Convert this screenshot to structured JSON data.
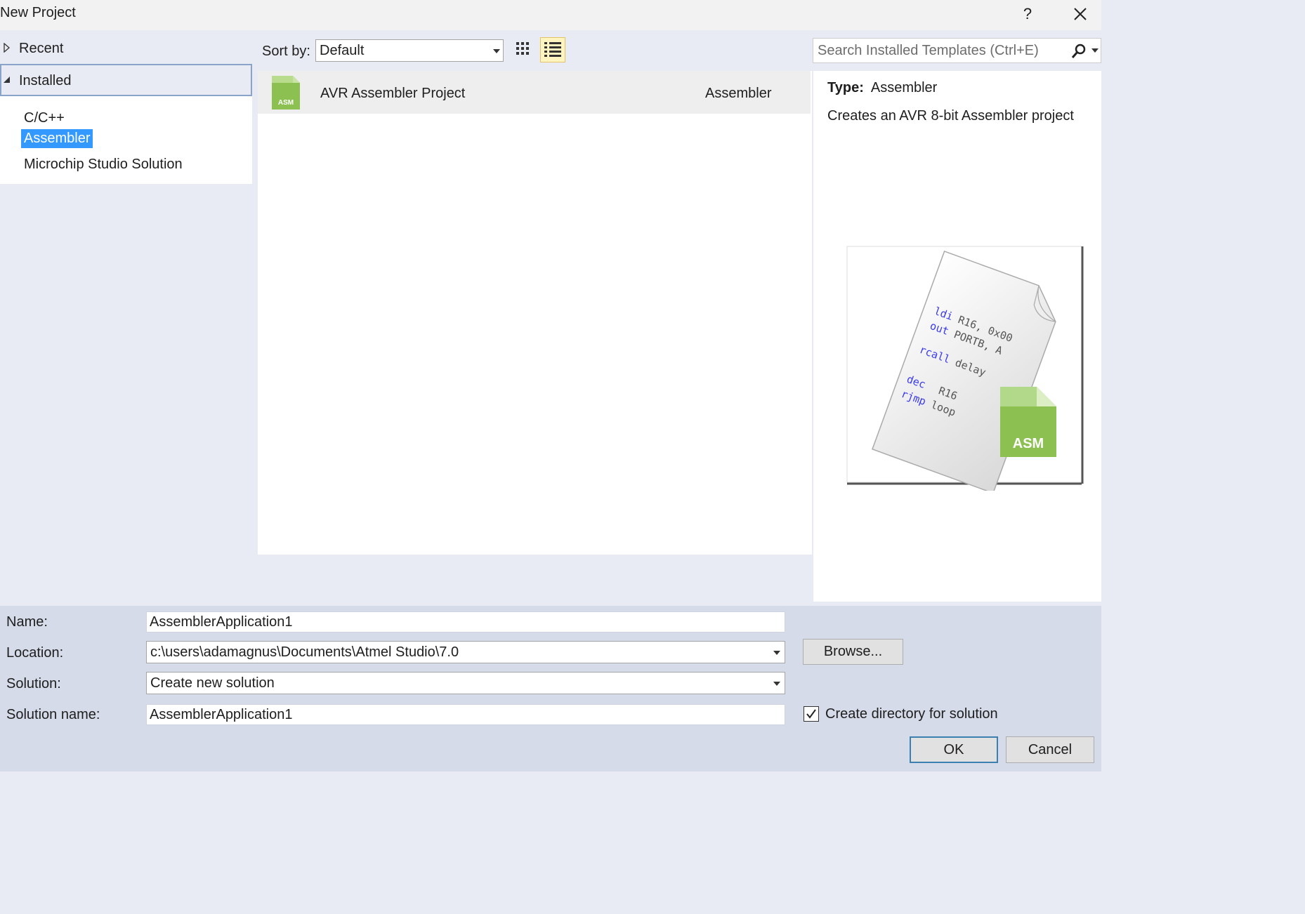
{
  "window": {
    "title": "New Project",
    "help_label": "?"
  },
  "sidebar": {
    "recent_label": "Recent",
    "installed_label": "Installed",
    "installed_items": [
      {
        "label": "C/C++",
        "selected": false
      },
      {
        "label": "Assembler",
        "selected": true
      },
      {
        "label": "Microchip Studio Solution",
        "selected": false
      }
    ]
  },
  "toolbar": {
    "sort_label": "Sort by:",
    "sort_value": "Default",
    "view_mode": "list"
  },
  "search": {
    "placeholder": "Search Installed Templates (Ctrl+E)"
  },
  "templates": [
    {
      "name": "AVR Assembler Project",
      "language": "Assembler",
      "icon": "asm-file-icon",
      "icon_badge": "ASM"
    }
  ],
  "details": {
    "type_label": "Type:",
    "type_value": "Assembler",
    "description": "Creates an AVR 8-bit Assembler project",
    "preview_badge": "ASM",
    "preview_code": [
      {
        "keyword": "ldi",
        "args": "R16, 0x00"
      },
      {
        "keyword": "out",
        "args": "PORTB, A"
      },
      {
        "keyword": "rcall",
        "args": "delay"
      },
      {
        "keyword": "dec",
        "args": "R16"
      },
      {
        "keyword": "rjmp",
        "args": "loop"
      }
    ]
  },
  "form": {
    "name_label": "Name:",
    "name_value": "AssemblerApplication1",
    "location_label": "Location:",
    "location_value": "c:\\users\\adamagnus\\Documents\\Atmel Studio\\7.0",
    "browse_label": "Browse...",
    "solution_label": "Solution:",
    "solution_value": "Create new solution",
    "solution_name_label": "Solution name:",
    "solution_name_value": "AssemblerApplication1",
    "create_dir_label": "Create directory for solution",
    "create_dir_checked": true,
    "ok_label": "OK",
    "cancel_label": "Cancel"
  },
  "colors": {
    "accent_selection": "#3399ff",
    "asm_green": "#8cc152",
    "list_view_highlight": "#fdf4bf",
    "code_keyword": "#3a3af0"
  }
}
